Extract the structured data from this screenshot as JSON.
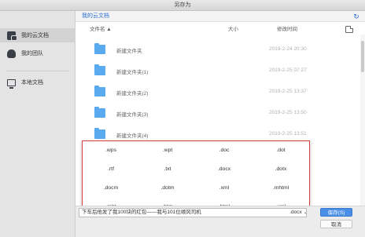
{
  "window": {
    "title": "另存为"
  },
  "sidebar": {
    "items": [
      {
        "label": "我的云文档",
        "icon": "cloud-doc-icon"
      },
      {
        "label": "我的团队",
        "icon": "team-icon"
      },
      {
        "label": "本地文档",
        "icon": "monitor-icon"
      }
    ]
  },
  "pathbar": {
    "path": "我的云文档",
    "refresh_icon": "↻"
  },
  "columns": {
    "name": "文件名 ▲",
    "size": "大小",
    "modified": "修改时间"
  },
  "files": [
    {
      "name": "新建文件夹",
      "date": "2019-2-24 20:30"
    },
    {
      "name": "新建文件夹(1)",
      "date": "2019-2-25 07:27"
    },
    {
      "name": "新建文件夹(2)",
      "date": "2019-2-25 13:37"
    },
    {
      "name": "新建文件夹(3)",
      "date": "2019-2-25 13:50"
    },
    {
      "name": "新建文件夹(4)",
      "date": "2019-2-25 13:51"
    }
  ],
  "formats": [
    [
      ".wps",
      ".wpt",
      ".doc",
      ".dot"
    ],
    [
      ".rtf",
      ".txt",
      ".docx",
      ".dotx"
    ],
    [
      ".docm",
      ".dotm",
      ".xml",
      ".mhtml"
    ],
    [
      ".mht",
      ".htm",
      ".html",
      ".xml"
    ]
  ],
  "footer": {
    "filename": "下车后他发了我100块的红包——我与101位顺风司机",
    "format": ".docx ⌄",
    "save_label": "保存(S)",
    "cancel_label": "取消"
  },
  "colors": {
    "accent": "#4a8fe7",
    "folder": "#5aaaf0",
    "highlight": "#d94040"
  }
}
